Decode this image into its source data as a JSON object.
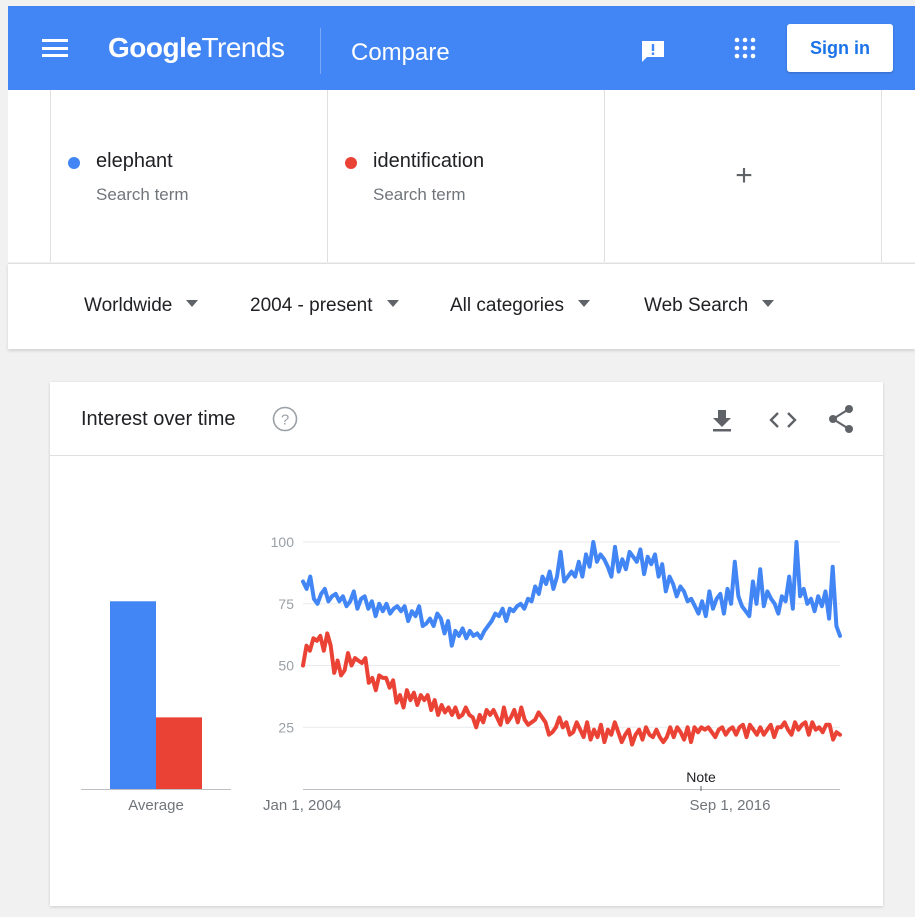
{
  "header": {
    "logo_google": "Google",
    "logo_trends": "Trends",
    "title": "Compare",
    "signin_label": "Sign in"
  },
  "icons": {
    "menu": "menu-icon",
    "feedback": "feedback-icon",
    "apps": "apps-grid-icon",
    "help": "help-icon",
    "download": "download-icon",
    "embed": "embed-icon",
    "share": "share-icon"
  },
  "terms": [
    {
      "name": "elephant",
      "sub": "Search term",
      "color": "#4285f4"
    },
    {
      "name": "identification",
      "sub": "Search term",
      "color": "#ea4335"
    }
  ],
  "add_term_label": "+",
  "filters": {
    "region": "Worldwide",
    "time": "2004 - present",
    "category": "All categories",
    "search_type": "Web Search"
  },
  "card": {
    "title": "Interest over time",
    "help_glyph": "?"
  },
  "chart_data": [
    {
      "type": "bar",
      "categories": [
        "Average"
      ],
      "series": [
        {
          "name": "elephant",
          "values": [
            76
          ],
          "color": "#4285f4"
        },
        {
          "name": "identification",
          "values": [
            29
          ],
          "color": "#ea4335"
        }
      ],
      "xlabel": "Average",
      "ylim": [
        0,
        100
      ]
    },
    {
      "type": "line",
      "x_start": "Jan 1, 2004",
      "x_end_approx": "2020",
      "x_ticks": [
        "Jan 1, 2004",
        "Sep 1, 2016"
      ],
      "y_ticks": [
        25,
        50,
        75,
        100
      ],
      "ylim": [
        0,
        100
      ],
      "annotation": "Note",
      "series": [
        {
          "name": "elephant",
          "color": "#4285f4",
          "values": [
            84,
            81,
            86,
            77,
            75,
            79,
            81,
            76,
            78,
            79,
            76,
            78,
            74,
            76,
            80,
            73,
            77,
            78,
            73,
            76,
            70,
            75,
            72,
            75,
            71,
            73,
            74,
            72,
            74,
            68,
            72,
            70,
            74,
            66,
            67,
            69,
            66,
            71,
            69,
            63,
            68,
            58,
            64,
            62,
            65,
            61,
            64,
            62,
            63,
            61,
            64,
            66,
            68,
            71,
            70,
            73,
            68,
            73,
            72,
            74,
            75,
            73,
            77,
            76,
            82,
            79,
            86,
            83,
            88,
            81,
            86,
            96,
            84,
            86,
            88,
            86,
            92,
            86,
            95,
            90,
            100,
            92,
            95,
            93,
            90,
            86,
            98,
            88,
            93,
            89,
            96,
            94,
            92,
            97,
            87,
            94,
            91,
            95,
            86,
            91,
            80,
            86,
            83,
            78,
            82,
            80,
            76,
            77,
            74,
            71,
            76,
            70,
            80,
            73,
            77,
            79,
            71,
            81,
            75,
            92,
            78,
            74,
            72,
            70,
            84,
            75,
            89,
            74,
            80,
            77,
            75,
            71,
            78,
            76,
            86,
            73,
            100,
            78,
            81,
            75,
            77,
            72,
            78,
            74,
            80,
            69,
            90,
            66,
            62
          ]
        },
        {
          "name": "identification",
          "color": "#ea4335",
          "values": [
            50,
            58,
            56,
            61,
            60,
            62,
            56,
            63,
            58,
            47,
            52,
            46,
            48,
            55,
            50,
            53,
            52,
            51,
            53,
            43,
            45,
            40,
            46,
            45,
            45,
            41,
            44,
            35,
            38,
            33,
            40,
            36,
            39,
            34,
            38,
            36,
            38,
            32,
            36,
            30,
            34,
            31,
            33,
            30,
            33,
            29,
            30,
            33,
            30,
            29,
            25,
            30,
            27,
            32,
            30,
            32,
            29,
            26,
            33,
            27,
            29,
            32,
            27,
            33,
            28,
            26,
            27,
            28,
            31,
            29,
            27,
            22,
            23,
            25,
            29,
            25,
            27,
            22,
            23,
            27,
            24,
            21,
            27,
            20,
            24,
            21,
            26,
            19,
            24,
            22,
            27,
            23,
            19,
            22,
            24,
            18,
            22,
            24,
            20,
            25,
            22,
            21,
            24,
            21,
            19,
            21,
            25,
            21,
            25,
            23,
            20,
            25,
            19,
            25,
            23,
            25,
            24,
            25,
            23,
            21,
            24,
            25,
            22,
            24,
            25,
            22,
            25,
            26,
            21,
            26,
            24,
            22,
            25,
            22,
            24,
            26,
            21,
            25,
            25,
            27,
            24,
            22,
            27,
            24,
            26,
            27,
            22,
            27,
            24,
            25,
            23,
            26,
            26,
            20,
            23,
            22
          ]
        }
      ]
    }
  ]
}
